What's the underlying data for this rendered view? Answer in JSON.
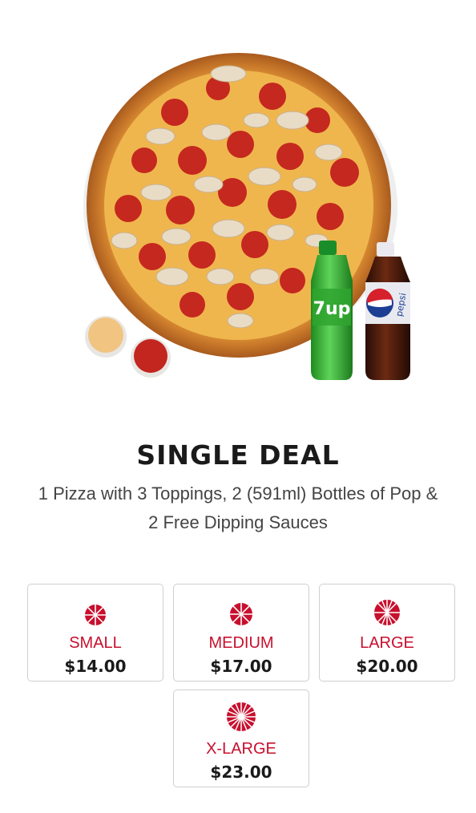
{
  "deal": {
    "title": "SINGLE DEAL",
    "description_line1": "1 Pizza with 3 Toppings, 2 (591ml) Bottles of Pop &",
    "description_line2": "2 Free Dipping Sauces"
  },
  "hero": {
    "bottle_left_label": "7up",
    "bottle_right_label": "pepsi"
  },
  "sizes": [
    {
      "label": "SMALL",
      "price": "$14.00",
      "icon": "pizza-icon"
    },
    {
      "label": "MEDIUM",
      "price": "$17.00",
      "icon": "pizza-icon"
    },
    {
      "label": "LARGE",
      "price": "$20.00",
      "icon": "pizza-icon"
    },
    {
      "label": "X-LARGE",
      "price": "$23.00",
      "icon": "pizza-icon"
    }
  ],
  "colors": {
    "accent": "#c8102e",
    "text": "#1a1a1a",
    "border": "#cfcfcf"
  }
}
